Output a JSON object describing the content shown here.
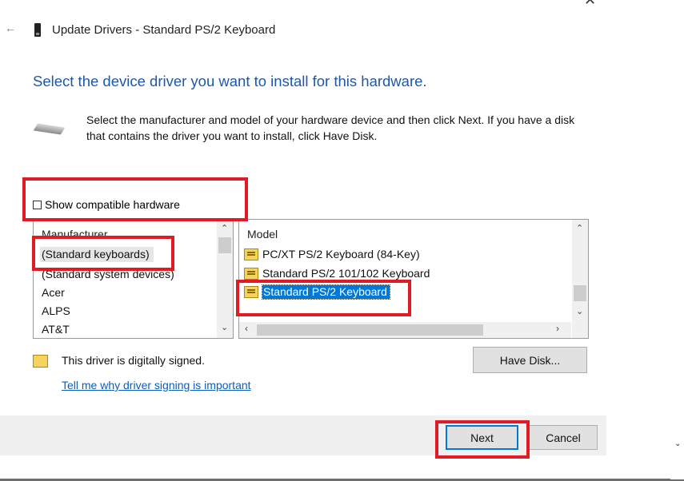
{
  "window": {
    "title": "Update Drivers - Standard PS/2 Keyboard",
    "back_icon": "back-arrow-icon",
    "close_icon": "close-icon"
  },
  "heading": "Select the device driver you want to install for this hardware.",
  "description": "Select the manufacturer and model of your hardware device and then click Next. If you have a disk that contains the driver you want to install, click Have Disk.",
  "show_compatible": {
    "label": "Show compatible hardware",
    "checked": false
  },
  "manufacturer": {
    "header": "Manufacturer",
    "items": [
      "(Standard keyboards)",
      "(Standard system devices)",
      "Acer",
      "ALPS",
      "AT&T"
    ],
    "selected": "(Standard keyboards)"
  },
  "model": {
    "header": "Model",
    "items": [
      "PC/XT PS/2 Keyboard (84-Key)",
      "Standard PS/2 101/102 Keyboard",
      "Standard PS/2 Keyboard"
    ],
    "selected": "Standard PS/2 Keyboard"
  },
  "signed": {
    "text": "This driver is digitally signed.",
    "link": "Tell me why driver signing is important"
  },
  "buttons": {
    "have_disk": "Have Disk...",
    "next": "Next",
    "cancel": "Cancel"
  },
  "colors": {
    "heading": "#1e58a8",
    "selection": "#0078d7",
    "highlight": "#e01b24",
    "link": "#0a5fbd"
  }
}
